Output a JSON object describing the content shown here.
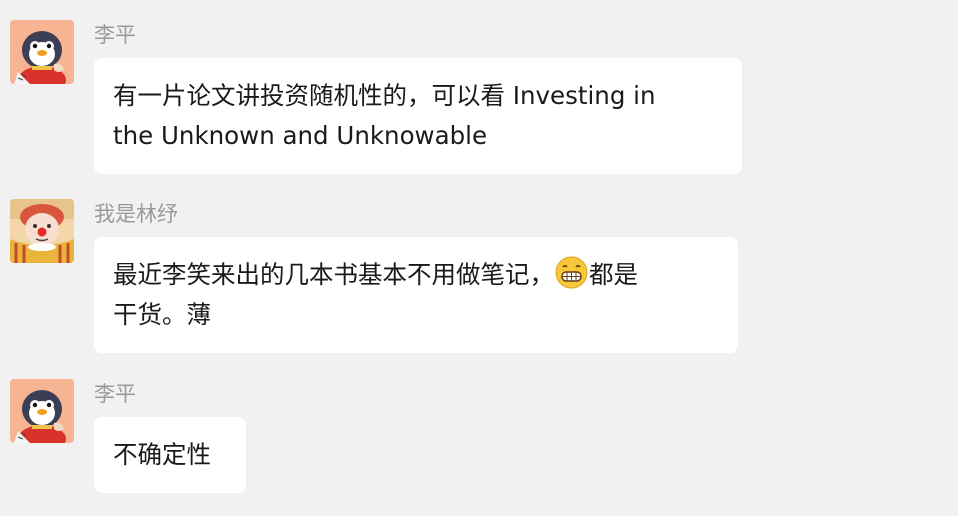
{
  "messages": [
    {
      "sender": "李平",
      "avatar_icon": "penguin-avatar",
      "lines": [
        "有一片论文讲投资随机性的，可以看 Investing in",
        "the Unknown and Unknowable"
      ]
    },
    {
      "sender": "我是林纾",
      "avatar_icon": "clown-avatar",
      "lines_first_part": "最近李笑来出的几本书基本不用做笔记，",
      "emoji_icon": "grinning-face-emoji",
      "lines_first_tail": "都是",
      "lines_second": "干货。薄"
    },
    {
      "sender": "李平",
      "avatar_icon": "penguin-avatar",
      "lines": [
        "不确定性"
      ]
    }
  ],
  "colors": {
    "background": "#f1f1f1",
    "bubble": "#ffffff",
    "sender_text": "#9a9a9a",
    "message_text": "#1a1a1a"
  }
}
